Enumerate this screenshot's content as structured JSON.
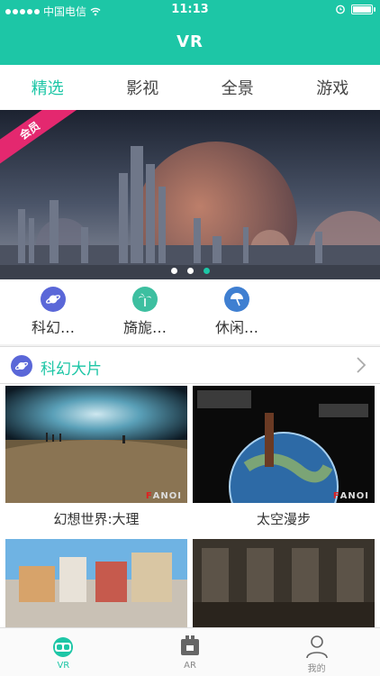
{
  "status_bar": {
    "carrier": "中国电信",
    "time": "11:13"
  },
  "header": {
    "title": "VR"
  },
  "tabs": [
    {
      "label": "精选",
      "active": true
    },
    {
      "label": "影视",
      "active": false
    },
    {
      "label": "全景",
      "active": false
    },
    {
      "label": "游戏",
      "active": false
    }
  ],
  "banner": {
    "ribbon_label": "会员",
    "page_count": 3,
    "active_page": 3
  },
  "quick_categories": [
    {
      "label": "科幻…",
      "icon": "planet-icon",
      "color": "#5a67d8"
    },
    {
      "label": "旖旎…",
      "icon": "palm-tree-icon",
      "color": "#3dbfa0"
    },
    {
      "label": "休闲…",
      "icon": "beach-umbrella-icon",
      "color": "#3f7fd1"
    }
  ],
  "section": {
    "title": "科幻大片",
    "icon": "planet-icon",
    "more_icon": "chevron-right-icon"
  },
  "videos": [
    {
      "title": "幻想世界:大理",
      "watermark": "FANOI"
    },
    {
      "title": "太空漫步",
      "watermark": "FANOI"
    },
    {
      "title": "",
      "watermark": ""
    },
    {
      "title": "",
      "watermark": ""
    }
  ],
  "bottom_nav": [
    {
      "label": "VR",
      "icon": "vr-headset-icon",
      "active": true
    },
    {
      "label": "AR",
      "icon": "ar-box-icon",
      "active": false
    },
    {
      "label": "我的",
      "icon": "user-icon",
      "active": false
    }
  ],
  "colors": {
    "accent": "#1dc6a6",
    "ribbon": "#e4286f",
    "section_icon": "#5a67d8"
  }
}
